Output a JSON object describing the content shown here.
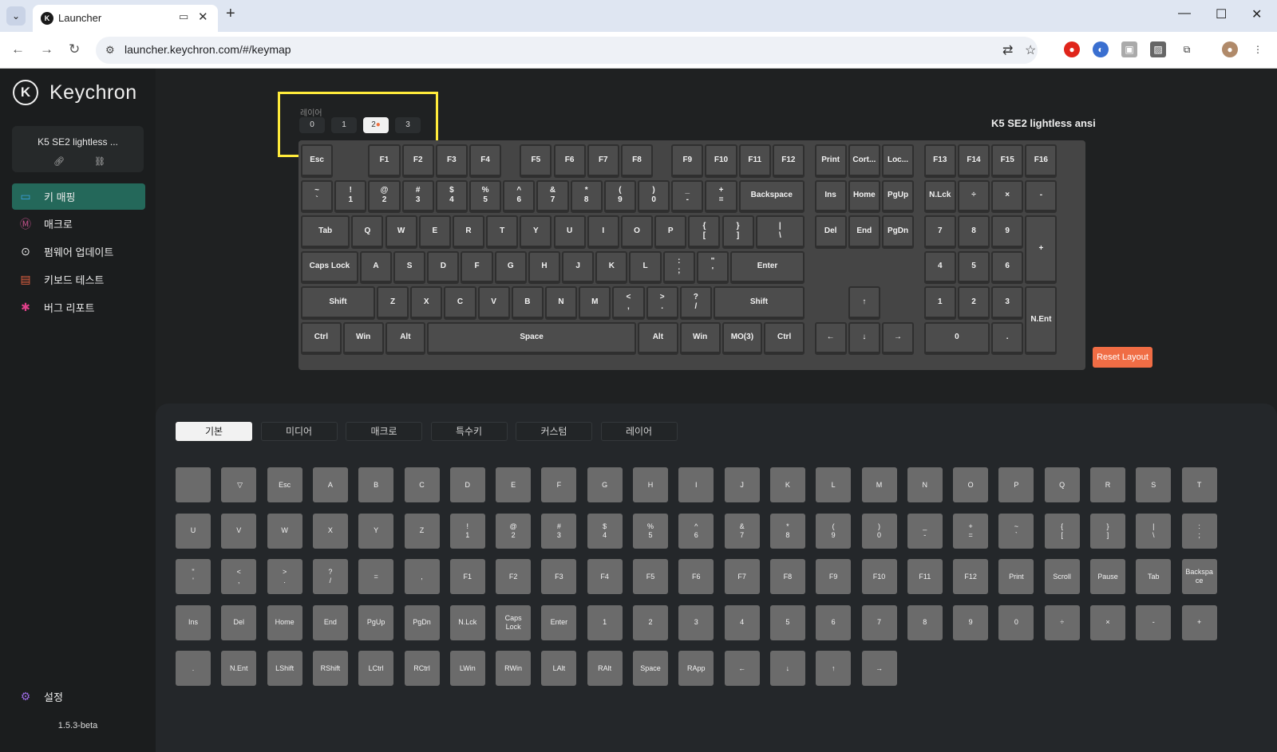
{
  "browser": {
    "tab_title": "Launcher",
    "tab_icon": "keychron-favicon",
    "url": "launcher.keychron.com/#/keymap"
  },
  "sidebar": {
    "brand": "Keychron",
    "logo_letter": "K",
    "device_name": "K5 SE2 lightless ...",
    "menu": [
      {
        "label": "키 매핑",
        "icon": "keyboard-icon",
        "active": true
      },
      {
        "label": "매크로",
        "icon": "macro-icon"
      },
      {
        "label": "펌웨어 업데이트",
        "icon": "firmware-update-icon"
      },
      {
        "label": "키보드 테스트",
        "icon": "keyboard-test-icon"
      },
      {
        "label": "버그 리포트",
        "icon": "bug-icon"
      }
    ],
    "settings": "설정",
    "version": "1.5.3-beta"
  },
  "layers": {
    "label": "레이어",
    "items": [
      "0",
      "1",
      "2",
      "3"
    ],
    "active": "2"
  },
  "keyboard": {
    "model": "K5 SE2 lightless ansi",
    "reset_label": "Reset Layout",
    "rows": [
      [
        "Esc",
        "F1",
        "F2",
        "F3",
        "F4",
        "F5",
        "F6",
        "F7",
        "F8",
        "F9",
        "F10",
        "F11",
        "F12",
        "Print",
        "Cort...",
        "Loc...",
        "F13",
        "F14",
        "F15",
        "F16"
      ],
      [
        "~\n`",
        "!\n1",
        "@\n2",
        "#\n3",
        "$\n4",
        "%\n5",
        "^\n6",
        "&\n7",
        "*\n8",
        "(\n9",
        ")\n0",
        "_\n-",
        "+\n=",
        "Backspace",
        "Ins",
        "Home",
        "PgUp",
        "N.Lck",
        "÷",
        "×",
        "-"
      ],
      [
        "Tab",
        "Q",
        "W",
        "E",
        "R",
        "T",
        "Y",
        "U",
        "I",
        "O",
        "P",
        "{\n[",
        "}\n]",
        "|\n\\",
        "Del",
        "End",
        "PgDn",
        "7",
        "8",
        "9",
        "+"
      ],
      [
        "Caps Lock",
        "A",
        "S",
        "D",
        "F",
        "G",
        "H",
        "J",
        "K",
        "L",
        ":\n;",
        "\"\n'",
        "Enter",
        "4",
        "5",
        "6"
      ],
      [
        "Shift",
        "Z",
        "X",
        "C",
        "V",
        "B",
        "N",
        "M",
        "<\n,",
        ">\n.",
        "?\n/",
        "Shift",
        "↑",
        "1",
        "2",
        "3",
        "N.Ent"
      ],
      [
        "Ctrl",
        "Win",
        "Alt",
        "Space",
        "Alt",
        "Win",
        "MO(3)",
        "Ctrl",
        "←",
        "↓",
        "→",
        "0",
        "."
      ]
    ]
  },
  "categories": {
    "tabs": [
      "기본",
      "미디어",
      "매크로",
      "특수키",
      "커스텀",
      "레이어"
    ],
    "active": "기본"
  },
  "palette": {
    "rows": [
      [
        "",
        " ▽",
        "Esc",
        "A",
        "B",
        "C",
        "D",
        "E",
        "F",
        "G",
        "H",
        "I",
        "J",
        "K",
        "L",
        "M",
        "N",
        "O",
        "P",
        "Q",
        "R",
        "S",
        "T"
      ],
      [
        "U",
        "V",
        "W",
        "X",
        "Y",
        "Z",
        "!\n1",
        "@\n2",
        "#\n3",
        "$\n4",
        "%\n5",
        "^\n6",
        "&\n7",
        "*\n8",
        "(\n9",
        ")\n0",
        "_\n-",
        "+\n=",
        "~\n`",
        "{\n[",
        "}\n]",
        "|\n\\",
        ":\n;"
      ],
      [
        "\"\n'",
        "<\n,",
        ">\n.",
        "?\n/",
        "=",
        ",",
        "F1",
        "F2",
        "F3",
        "F4",
        "F5",
        "F6",
        "F7",
        "F8",
        "F9",
        "F10",
        "F11",
        "F12",
        "Print",
        "Scroll",
        "Pause",
        "Tab",
        "Backspa\nce"
      ],
      [
        "Ins",
        "Del",
        "Home",
        "End",
        "PgUp",
        "PgDn",
        "N.Lck",
        "Caps\nLock",
        "Enter",
        "1",
        "2",
        "3",
        "4",
        "5",
        "6",
        "7",
        "8",
        "9",
        "0",
        "÷",
        "×",
        "-",
        "+"
      ],
      [
        ".",
        "N.Ent",
        "LShift",
        "RShift",
        "LCtrl",
        "RCtrl",
        "LWin",
        "RWin",
        "LAlt",
        "RAlt",
        "Space",
        "RApp",
        "←",
        "↓",
        "↑",
        "→"
      ]
    ]
  },
  "colors": {
    "accent_active_menu": "#24685a",
    "reset_button": "#f06d45",
    "highlight_box": "#ffeb3b"
  }
}
